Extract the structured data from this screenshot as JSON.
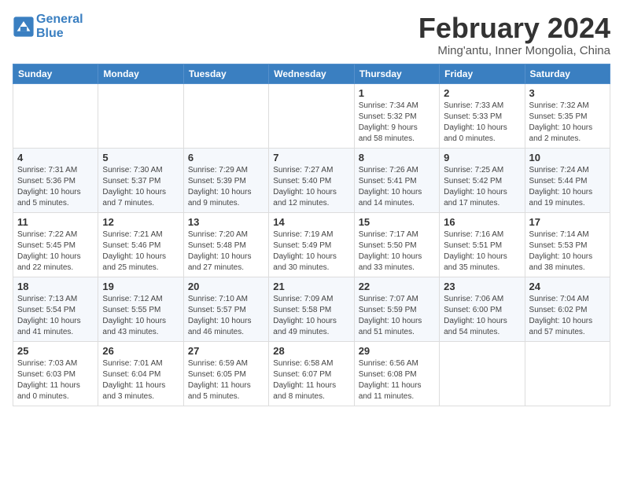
{
  "logo": {
    "line1": "General",
    "line2": "Blue"
  },
  "title": "February 2024",
  "location": "Ming'antu, Inner Mongolia, China",
  "weekdays": [
    "Sunday",
    "Monday",
    "Tuesday",
    "Wednesday",
    "Thursday",
    "Friday",
    "Saturday"
  ],
  "weeks": [
    [
      {
        "day": "",
        "info": ""
      },
      {
        "day": "",
        "info": ""
      },
      {
        "day": "",
        "info": ""
      },
      {
        "day": "",
        "info": ""
      },
      {
        "day": "1",
        "info": "Sunrise: 7:34 AM\nSunset: 5:32 PM\nDaylight: 9 hours\nand 58 minutes."
      },
      {
        "day": "2",
        "info": "Sunrise: 7:33 AM\nSunset: 5:33 PM\nDaylight: 10 hours\nand 0 minutes."
      },
      {
        "day": "3",
        "info": "Sunrise: 7:32 AM\nSunset: 5:35 PM\nDaylight: 10 hours\nand 2 minutes."
      }
    ],
    [
      {
        "day": "4",
        "info": "Sunrise: 7:31 AM\nSunset: 5:36 PM\nDaylight: 10 hours\nand 5 minutes."
      },
      {
        "day": "5",
        "info": "Sunrise: 7:30 AM\nSunset: 5:37 PM\nDaylight: 10 hours\nand 7 minutes."
      },
      {
        "day": "6",
        "info": "Sunrise: 7:29 AM\nSunset: 5:39 PM\nDaylight: 10 hours\nand 9 minutes."
      },
      {
        "day": "7",
        "info": "Sunrise: 7:27 AM\nSunset: 5:40 PM\nDaylight: 10 hours\nand 12 minutes."
      },
      {
        "day": "8",
        "info": "Sunrise: 7:26 AM\nSunset: 5:41 PM\nDaylight: 10 hours\nand 14 minutes."
      },
      {
        "day": "9",
        "info": "Sunrise: 7:25 AM\nSunset: 5:42 PM\nDaylight: 10 hours\nand 17 minutes."
      },
      {
        "day": "10",
        "info": "Sunrise: 7:24 AM\nSunset: 5:44 PM\nDaylight: 10 hours\nand 19 minutes."
      }
    ],
    [
      {
        "day": "11",
        "info": "Sunrise: 7:22 AM\nSunset: 5:45 PM\nDaylight: 10 hours\nand 22 minutes."
      },
      {
        "day": "12",
        "info": "Sunrise: 7:21 AM\nSunset: 5:46 PM\nDaylight: 10 hours\nand 25 minutes."
      },
      {
        "day": "13",
        "info": "Sunrise: 7:20 AM\nSunset: 5:48 PM\nDaylight: 10 hours\nand 27 minutes."
      },
      {
        "day": "14",
        "info": "Sunrise: 7:19 AM\nSunset: 5:49 PM\nDaylight: 10 hours\nand 30 minutes."
      },
      {
        "day": "15",
        "info": "Sunrise: 7:17 AM\nSunset: 5:50 PM\nDaylight: 10 hours\nand 33 minutes."
      },
      {
        "day": "16",
        "info": "Sunrise: 7:16 AM\nSunset: 5:51 PM\nDaylight: 10 hours\nand 35 minutes."
      },
      {
        "day": "17",
        "info": "Sunrise: 7:14 AM\nSunset: 5:53 PM\nDaylight: 10 hours\nand 38 minutes."
      }
    ],
    [
      {
        "day": "18",
        "info": "Sunrise: 7:13 AM\nSunset: 5:54 PM\nDaylight: 10 hours\nand 41 minutes."
      },
      {
        "day": "19",
        "info": "Sunrise: 7:12 AM\nSunset: 5:55 PM\nDaylight: 10 hours\nand 43 minutes."
      },
      {
        "day": "20",
        "info": "Sunrise: 7:10 AM\nSunset: 5:57 PM\nDaylight: 10 hours\nand 46 minutes."
      },
      {
        "day": "21",
        "info": "Sunrise: 7:09 AM\nSunset: 5:58 PM\nDaylight: 10 hours\nand 49 minutes."
      },
      {
        "day": "22",
        "info": "Sunrise: 7:07 AM\nSunset: 5:59 PM\nDaylight: 10 hours\nand 51 minutes."
      },
      {
        "day": "23",
        "info": "Sunrise: 7:06 AM\nSunset: 6:00 PM\nDaylight: 10 hours\nand 54 minutes."
      },
      {
        "day": "24",
        "info": "Sunrise: 7:04 AM\nSunset: 6:02 PM\nDaylight: 10 hours\nand 57 minutes."
      }
    ],
    [
      {
        "day": "25",
        "info": "Sunrise: 7:03 AM\nSunset: 6:03 PM\nDaylight: 11 hours\nand 0 minutes."
      },
      {
        "day": "26",
        "info": "Sunrise: 7:01 AM\nSunset: 6:04 PM\nDaylight: 11 hours\nand 3 minutes."
      },
      {
        "day": "27",
        "info": "Sunrise: 6:59 AM\nSunset: 6:05 PM\nDaylight: 11 hours\nand 5 minutes."
      },
      {
        "day": "28",
        "info": "Sunrise: 6:58 AM\nSunset: 6:07 PM\nDaylight: 11 hours\nand 8 minutes."
      },
      {
        "day": "29",
        "info": "Sunrise: 6:56 AM\nSunset: 6:08 PM\nDaylight: 11 hours\nand 11 minutes."
      },
      {
        "day": "",
        "info": ""
      },
      {
        "day": "",
        "info": ""
      }
    ]
  ]
}
